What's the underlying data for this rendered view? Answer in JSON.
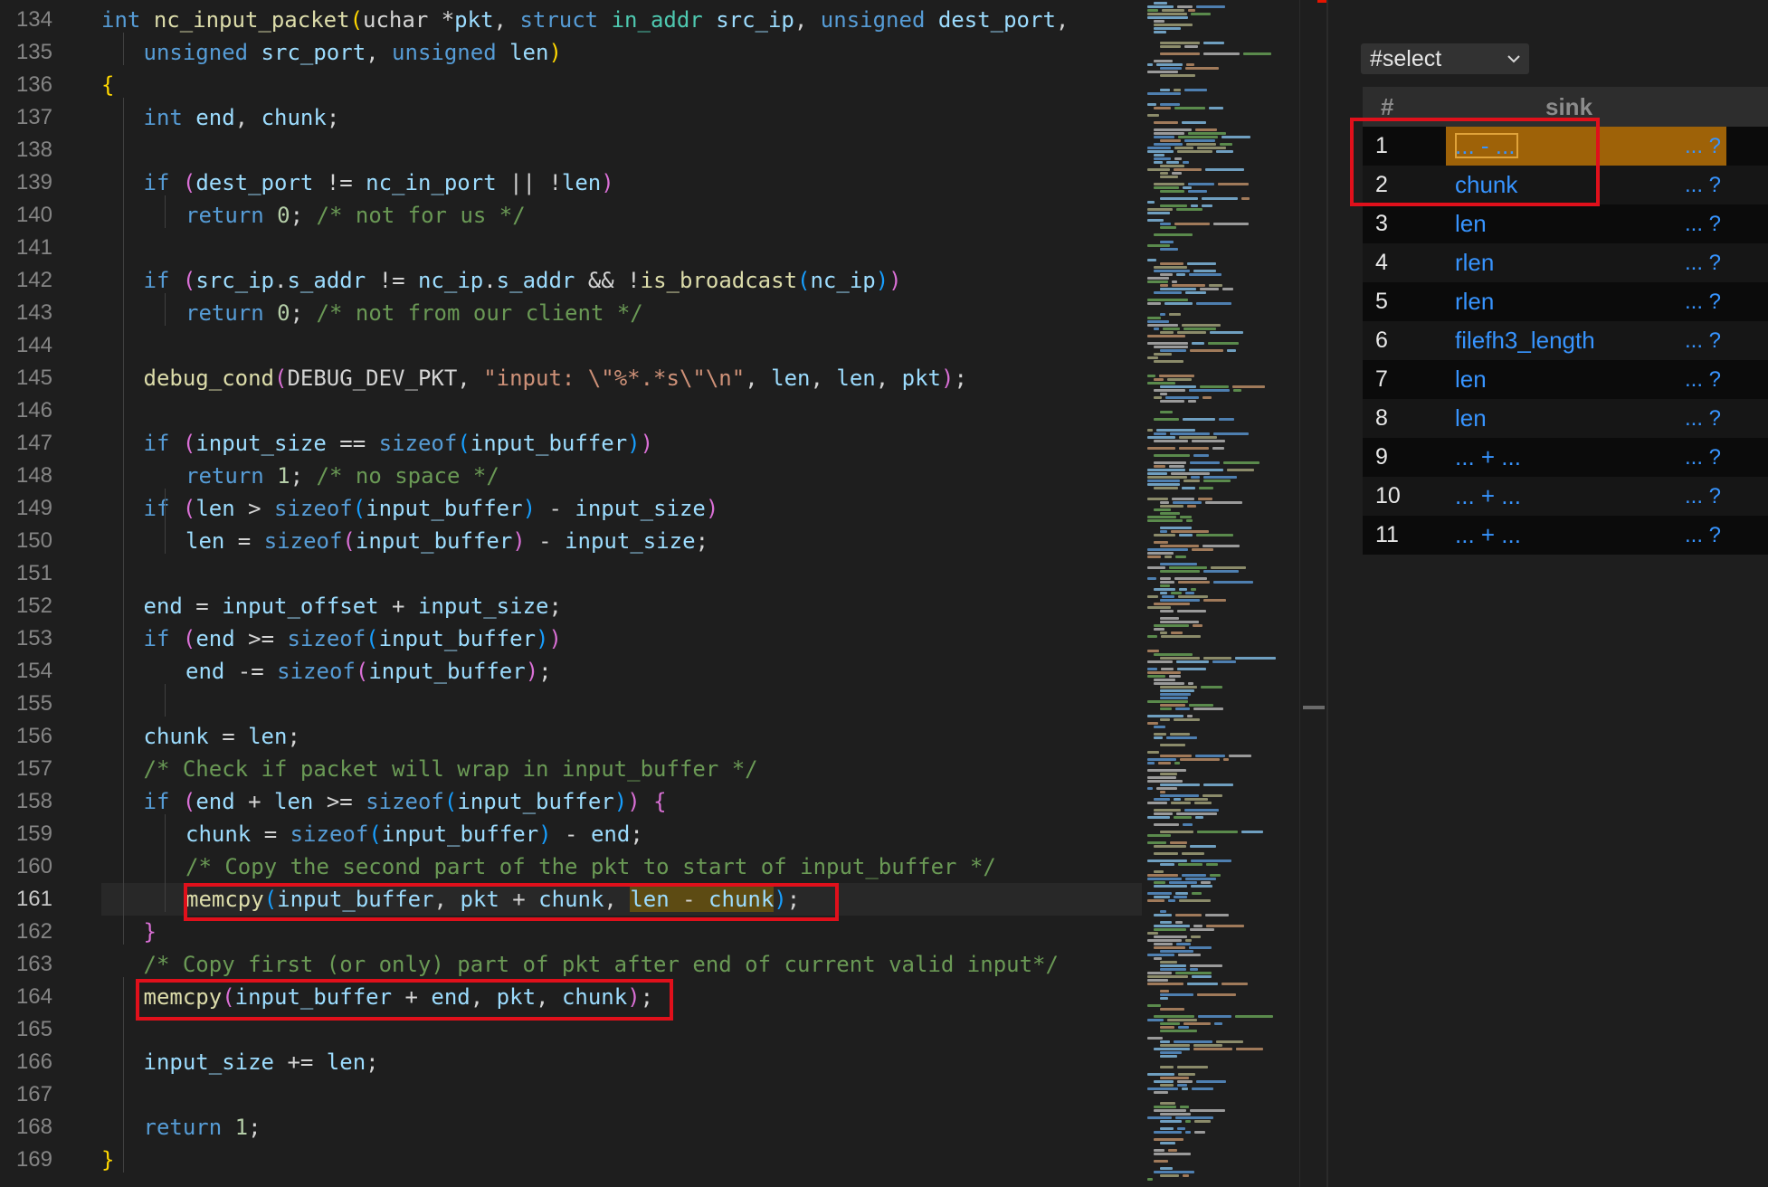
{
  "editor": {
    "active_line": "161",
    "lines": [
      {
        "n": "134",
        "indent": 0,
        "tokens": [
          [
            "int",
            "kw"
          ],
          [
            " ",
            "p"
          ],
          [
            "nc_input_packet",
            "fn"
          ],
          [
            "(",
            "br1"
          ],
          [
            "uchar ",
            "p"
          ],
          [
            "*",
            "p"
          ],
          [
            "pkt",
            "id"
          ],
          [
            ", ",
            "p"
          ],
          [
            "struct ",
            "kw"
          ],
          [
            "in_addr ",
            "ty"
          ],
          [
            "src_ip",
            "id"
          ],
          [
            ", ",
            "p"
          ],
          [
            "unsigned ",
            "kw"
          ],
          [
            "dest_port",
            "id"
          ],
          [
            ",",
            "p"
          ]
        ]
      },
      {
        "n": "135",
        "indent": 1,
        "tokens": [
          [
            "unsigned ",
            "kw"
          ],
          [
            "src_port",
            "id"
          ],
          [
            ", ",
            "p"
          ],
          [
            "unsigned ",
            "kw"
          ],
          [
            "len",
            "id"
          ],
          [
            ")",
            "br1"
          ]
        ]
      },
      {
        "n": "136",
        "indent": 0,
        "tokens": [
          [
            "{",
            "br1"
          ]
        ]
      },
      {
        "n": "137",
        "indent": 1,
        "tokens": [
          [
            "int ",
            "kw"
          ],
          [
            "end",
            "id"
          ],
          [
            ", ",
            "p"
          ],
          [
            "chunk",
            "id"
          ],
          [
            ";",
            "p"
          ]
        ]
      },
      {
        "n": "138",
        "indent": 0,
        "tokens": []
      },
      {
        "n": "139",
        "indent": 1,
        "tokens": [
          [
            "if ",
            "kw"
          ],
          [
            "(",
            "br2"
          ],
          [
            "dest_port",
            "id"
          ],
          [
            " != ",
            "p"
          ],
          [
            "nc_in_port",
            "id"
          ],
          [
            " || !",
            "p"
          ],
          [
            "len",
            "id"
          ],
          [
            ")",
            "br2"
          ]
        ]
      },
      {
        "n": "140",
        "indent": 2,
        "tokens": [
          [
            "return ",
            "kw"
          ],
          [
            "0",
            "num"
          ],
          [
            "; ",
            "p"
          ],
          [
            "/* not for us */",
            "cm"
          ]
        ]
      },
      {
        "n": "141",
        "indent": 0,
        "tokens": []
      },
      {
        "n": "142",
        "indent": 1,
        "tokens": [
          [
            "if ",
            "kw"
          ],
          [
            "(",
            "br2"
          ],
          [
            "src_ip",
            "id"
          ],
          [
            ".",
            "p"
          ],
          [
            "s_addr",
            "id"
          ],
          [
            " != ",
            "p"
          ],
          [
            "nc_ip",
            "id"
          ],
          [
            ".",
            "p"
          ],
          [
            "s_addr",
            "id"
          ],
          [
            " && !",
            "p"
          ],
          [
            "is_broadcast",
            "fn"
          ],
          [
            "(",
            "br3"
          ],
          [
            "nc_ip",
            "id"
          ],
          [
            ")",
            "br3"
          ],
          [
            ")",
            "br2"
          ]
        ]
      },
      {
        "n": "143",
        "indent": 2,
        "tokens": [
          [
            "return ",
            "kw"
          ],
          [
            "0",
            "num"
          ],
          [
            "; ",
            "p"
          ],
          [
            "/* not from our client */",
            "cm"
          ]
        ]
      },
      {
        "n": "144",
        "indent": 0,
        "tokens": []
      },
      {
        "n": "145",
        "indent": 1,
        "tokens": [
          [
            "debug_cond",
            "fn"
          ],
          [
            "(",
            "br2"
          ],
          [
            "DEBUG_DEV_PKT",
            "p"
          ],
          [
            ", ",
            "p"
          ],
          [
            "\"input: ",
            "str"
          ],
          [
            "\\\"",
            "str"
          ],
          [
            "%*.*s",
            "str"
          ],
          [
            "\\\"",
            "str"
          ],
          [
            "\\n",
            "str"
          ],
          [
            "\"",
            "str"
          ],
          [
            ", ",
            "p"
          ],
          [
            "len",
            "id"
          ],
          [
            ", ",
            "p"
          ],
          [
            "len",
            "id"
          ],
          [
            ", ",
            "p"
          ],
          [
            "pkt",
            "id"
          ],
          [
            ")",
            "br2"
          ],
          [
            ";",
            "p"
          ]
        ]
      },
      {
        "n": "146",
        "indent": 0,
        "tokens": []
      },
      {
        "n": "147",
        "indent": 1,
        "tokens": [
          [
            "if ",
            "kw"
          ],
          [
            "(",
            "br2"
          ],
          [
            "input_size",
            "id"
          ],
          [
            " == ",
            "p"
          ],
          [
            "sizeof",
            "kw"
          ],
          [
            "(",
            "br3"
          ],
          [
            "input_buffer",
            "id"
          ],
          [
            ")",
            "br3"
          ],
          [
            ")",
            "br2"
          ]
        ]
      },
      {
        "n": "148",
        "indent": 2,
        "tokens": [
          [
            "return ",
            "kw"
          ],
          [
            "1",
            "num"
          ],
          [
            "; ",
            "p"
          ],
          [
            "/* no space */",
            "cm"
          ]
        ]
      },
      {
        "n": "149",
        "indent": 1,
        "tokens": [
          [
            "if ",
            "kw"
          ],
          [
            "(",
            "br2"
          ],
          [
            "len",
            "id"
          ],
          [
            " > ",
            "p"
          ],
          [
            "sizeof",
            "kw"
          ],
          [
            "(",
            "br3"
          ],
          [
            "input_buffer",
            "id"
          ],
          [
            ")",
            "br3"
          ],
          [
            " - ",
            "p"
          ],
          [
            "input_size",
            "id"
          ],
          [
            ")",
            "br2"
          ]
        ]
      },
      {
        "n": "150",
        "indent": 2,
        "tokens": [
          [
            "len",
            "id"
          ],
          [
            " = ",
            "p"
          ],
          [
            "sizeof",
            "kw"
          ],
          [
            "(",
            "br2"
          ],
          [
            "input_buffer",
            "id"
          ],
          [
            ")",
            "br2"
          ],
          [
            " - ",
            "p"
          ],
          [
            "input_size",
            "id"
          ],
          [
            ";",
            "p"
          ]
        ]
      },
      {
        "n": "151",
        "indent": 0,
        "tokens": []
      },
      {
        "n": "152",
        "indent": 1,
        "tokens": [
          [
            "end",
            "id"
          ],
          [
            " = ",
            "p"
          ],
          [
            "input_offset",
            "id"
          ],
          [
            " + ",
            "p"
          ],
          [
            "input_size",
            "id"
          ],
          [
            ";",
            "p"
          ]
        ]
      },
      {
        "n": "153",
        "indent": 1,
        "tokens": [
          [
            "if ",
            "kw"
          ],
          [
            "(",
            "br2"
          ],
          [
            "end",
            "id"
          ],
          [
            " >= ",
            "p"
          ],
          [
            "sizeof",
            "kw"
          ],
          [
            "(",
            "br3"
          ],
          [
            "input_buffer",
            "id"
          ],
          [
            ")",
            "br3"
          ],
          [
            ")",
            "br2"
          ]
        ]
      },
      {
        "n": "154",
        "indent": 2,
        "tokens": [
          [
            "end",
            "id"
          ],
          [
            " -= ",
            "p"
          ],
          [
            "sizeof",
            "kw"
          ],
          [
            "(",
            "br2"
          ],
          [
            "input_buffer",
            "id"
          ],
          [
            ")",
            "br2"
          ],
          [
            ";",
            "p"
          ]
        ]
      },
      {
        "n": "155",
        "indent": 0,
        "tokens": []
      },
      {
        "n": "156",
        "indent": 1,
        "tokens": [
          [
            "chunk",
            "id"
          ],
          [
            " = ",
            "p"
          ],
          [
            "len",
            "id"
          ],
          [
            ";",
            "p"
          ]
        ]
      },
      {
        "n": "157",
        "indent": 1,
        "tokens": [
          [
            "/* Check if packet will wrap in input_buffer */",
            "cm"
          ]
        ]
      },
      {
        "n": "158",
        "indent": 1,
        "tokens": [
          [
            "if ",
            "kw"
          ],
          [
            "(",
            "br2"
          ],
          [
            "end",
            "id"
          ],
          [
            " + ",
            "p"
          ],
          [
            "len",
            "id"
          ],
          [
            " >= ",
            "p"
          ],
          [
            "sizeof",
            "kw"
          ],
          [
            "(",
            "br3"
          ],
          [
            "input_buffer",
            "id"
          ],
          [
            ")",
            "br3"
          ],
          [
            ")",
            "br2"
          ],
          [
            " ",
            "p"
          ],
          [
            "{",
            "br2"
          ]
        ]
      },
      {
        "n": "159",
        "indent": 2,
        "tokens": [
          [
            "chunk",
            "id"
          ],
          [
            " = ",
            "p"
          ],
          [
            "sizeof",
            "kw"
          ],
          [
            "(",
            "br3"
          ],
          [
            "input_buffer",
            "id"
          ],
          [
            ")",
            "br3"
          ],
          [
            " - ",
            "p"
          ],
          [
            "end",
            "id"
          ],
          [
            ";",
            "p"
          ]
        ]
      },
      {
        "n": "160",
        "indent": 2,
        "tokens": [
          [
            "/* Copy the second part of the pkt to start of input_buffer */",
            "cm"
          ]
        ]
      },
      {
        "n": "161",
        "indent": 2,
        "tokens": [
          [
            "memcpy",
            "fn"
          ],
          [
            "(",
            "br3"
          ],
          [
            "input_buffer",
            "id"
          ],
          [
            ", ",
            "p"
          ],
          [
            "pkt",
            "id"
          ],
          [
            " + ",
            "p"
          ],
          [
            "chunk",
            "id"
          ],
          [
            ", ",
            "p"
          ],
          [
            "len",
            "id",
            "hl"
          ],
          [
            " - ",
            "p",
            "hl"
          ],
          [
            "chunk",
            "id",
            "hl"
          ],
          [
            ")",
            "br3"
          ],
          [
            ";",
            "p"
          ]
        ]
      },
      {
        "n": "162",
        "indent": 1,
        "tokens": [
          [
            "}",
            "br2"
          ]
        ]
      },
      {
        "n": "163",
        "indent": 1,
        "tokens": [
          [
            "/* Copy first (or only) part of pkt after end of current valid input*/",
            "cm"
          ]
        ]
      },
      {
        "n": "164",
        "indent": 1,
        "tokens": [
          [
            "memcpy",
            "fn"
          ],
          [
            "(",
            "br2"
          ],
          [
            "input_buffer",
            "id"
          ],
          [
            " + ",
            "p"
          ],
          [
            "end",
            "id"
          ],
          [
            ", ",
            "p"
          ],
          [
            "pkt",
            "id"
          ],
          [
            ", ",
            "p"
          ],
          [
            "chunk",
            "id"
          ],
          [
            ")",
            "br2"
          ],
          [
            ";",
            "p"
          ]
        ]
      },
      {
        "n": "165",
        "indent": 0,
        "tokens": []
      },
      {
        "n": "166",
        "indent": 1,
        "tokens": [
          [
            "input_size",
            "id"
          ],
          [
            " += ",
            "p"
          ],
          [
            "len",
            "id"
          ],
          [
            ";",
            "p"
          ]
        ]
      },
      {
        "n": "167",
        "indent": 0,
        "tokens": []
      },
      {
        "n": "168",
        "indent": 1,
        "tokens": [
          [
            "return ",
            "kw"
          ],
          [
            "1",
            "num"
          ],
          [
            ";",
            "p"
          ]
        ]
      },
      {
        "n": "169",
        "indent": 0,
        "tokens": [
          [
            "}",
            "br1"
          ]
        ]
      }
    ]
  },
  "panel": {
    "select_label": "#select",
    "columns": {
      "num": "#",
      "sink": "sink"
    },
    "more_text": "... ?",
    "selected_row": 0,
    "rows": [
      {
        "num": "1",
        "sink": "... - ..."
      },
      {
        "num": "2",
        "sink": "chunk"
      },
      {
        "num": "3",
        "sink": "len"
      },
      {
        "num": "4",
        "sink": "rlen"
      },
      {
        "num": "5",
        "sink": "rlen"
      },
      {
        "num": "6",
        "sink": "filefh3_length"
      },
      {
        "num": "7",
        "sink": "len"
      },
      {
        "num": "8",
        "sink": "len"
      },
      {
        "num": "9",
        "sink": "... + ..."
      },
      {
        "num": "10",
        "sink": "... + ..."
      },
      {
        "num": "11",
        "sink": "... + ..."
      }
    ]
  },
  "colors": {
    "keyword": "#569cd6",
    "function": "#dcdcaa",
    "identifier": "#9cdcfe",
    "comment": "#6a9955",
    "highlight": "#5d4b13",
    "annotation_box": "#e0101b",
    "selected_cell": "#9e6208",
    "link": "#3794ff"
  }
}
